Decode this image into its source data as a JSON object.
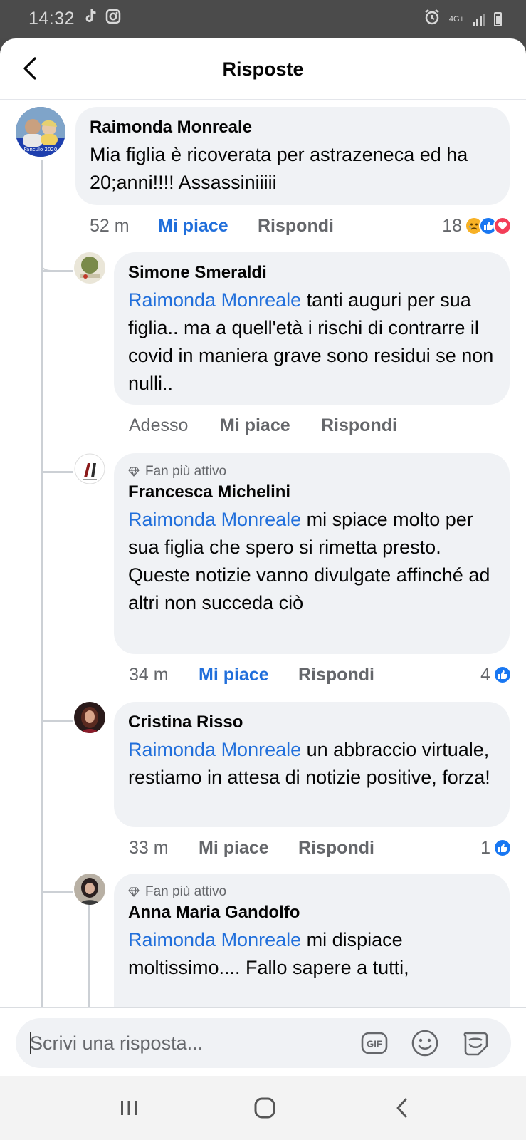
{
  "status_bar": {
    "time": "14:32",
    "left_icons": [
      "tiktok-icon",
      "instagram-icon"
    ],
    "network_label": "4G+",
    "right_icons": [
      "alarm-icon",
      "signal-icon",
      "battery-icon"
    ]
  },
  "header": {
    "title": "Risposte",
    "back_icon": "chevron-left-icon"
  },
  "comments": [
    {
      "author": "Raimonda Monreale",
      "avatar_caption": "Fanculo 2020",
      "mention": "",
      "text": "Mia figlia è ricoverata per astrazeneca ed ha 20;anni!!!! Assassiniiiii",
      "time": "52 m",
      "like_label": "Mi piace",
      "reply_label": "Rispondi",
      "liked": true,
      "reaction_count": "18",
      "reaction_icons": [
        "sad-reaction-icon",
        "like-reaction-icon",
        "love-reaction-icon"
      ]
    },
    {
      "author": "Simone Smeraldi",
      "mention": "Raimonda Monreale",
      "text": " tanti auguri per sua figlia.. ma a quell'età i rischi di contrarre il covid in maniera grave sono residui se non nulli..",
      "time": "Adesso",
      "like_label": "Mi piace",
      "reply_label": "Rispondi",
      "liked": false,
      "reaction_count": "",
      "reaction_icons": []
    },
    {
      "author": "Francesca Michelini",
      "badge": "Fan più attivo",
      "mention": "Raimonda Monreale",
      "text": " mi spiace molto per sua figlia che spero si rimetta presto. Queste notizie vanno divulgate affinché ad altri non succeda ciò",
      "time": "34 m",
      "like_label": "Mi piace",
      "reply_label": "Rispondi",
      "liked": true,
      "reaction_count": "4",
      "reaction_icons": [
        "like-reaction-icon"
      ]
    },
    {
      "author": "Cristina Risso",
      "mention": "Raimonda Monreale",
      "text": " un abbraccio virtuale, restiamo in attesa di notizie positive, forza!",
      "time": "33 m",
      "like_label": "Mi piace",
      "reply_label": "Rispondi",
      "liked": false,
      "reaction_count": "1",
      "reaction_icons": [
        "like-reaction-icon"
      ]
    },
    {
      "author": "Anna Maria Gandolfo",
      "badge": "Fan più attivo",
      "mention": "Raimonda Monreale",
      "text": " mi dispiace moltissimo.... Fallo sapere a tutti,",
      "time": "",
      "like_label": "",
      "reply_label": "",
      "liked": false,
      "reaction_count": "",
      "reaction_icons": []
    }
  ],
  "composer": {
    "placeholder": "Scrivi una risposta...",
    "value": "",
    "icons": [
      "gif-icon",
      "emoji-icon",
      "sticker-icon"
    ],
    "gif_label": "GIF"
  },
  "navbar": {
    "icons": [
      "recent-apps-icon",
      "home-icon",
      "back-icon"
    ]
  },
  "colors": {
    "accent": "#216fdb",
    "like_blue": "#1877f2",
    "bubble": "#f0f2f5",
    "secondary_text": "#65676b"
  }
}
